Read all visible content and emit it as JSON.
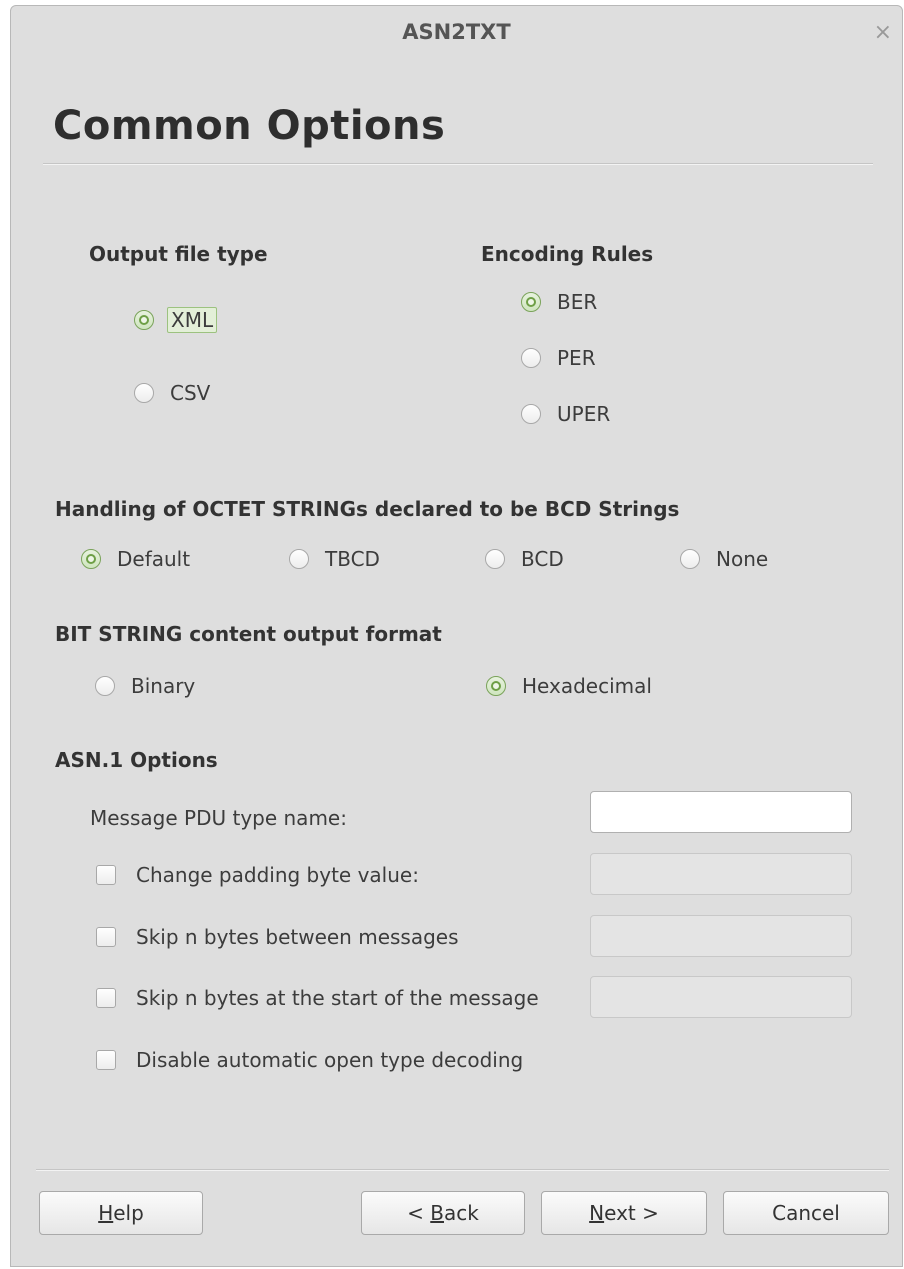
{
  "window": {
    "title": "ASN2TXT",
    "close_glyph": "×"
  },
  "page": {
    "heading": "Common Options"
  },
  "output_file_type": {
    "title": "Output file type",
    "options": [
      {
        "label": "XML",
        "checked": true
      },
      {
        "label": "CSV",
        "checked": false
      }
    ]
  },
  "encoding_rules": {
    "title": "Encoding Rules",
    "options": [
      {
        "label": "BER",
        "checked": true
      },
      {
        "label": "PER",
        "checked": false
      },
      {
        "label": "UPER",
        "checked": false
      }
    ]
  },
  "bcd_handling": {
    "title": "Handling of OCTET STRINGs declared to be BCD Strings",
    "options": [
      {
        "label": "Default",
        "checked": true
      },
      {
        "label": "TBCD",
        "checked": false
      },
      {
        "label": "BCD",
        "checked": false
      },
      {
        "label": "None",
        "checked": false
      }
    ]
  },
  "bit_string_format": {
    "title": "BIT STRING content output format",
    "options": [
      {
        "label": "Binary",
        "checked": false
      },
      {
        "label": "Hexadecimal",
        "checked": true
      }
    ]
  },
  "asn1_options": {
    "title": "ASN.1 Options",
    "pdu_label": "Message PDU type name:",
    "pdu_value": "",
    "padding_label": "Change padding byte value:",
    "padding_value": "",
    "skip_between_label": "Skip n bytes between messages",
    "skip_between_value": "",
    "skip_start_label": "Skip n bytes at the start of the message",
    "skip_start_value": "",
    "disable_open_type_label": "Disable automatic open type decoding"
  },
  "buttons": {
    "help": {
      "mnemonic": "H",
      "rest": "elp"
    },
    "back": {
      "prefix": "< ",
      "mnemonic": "B",
      "rest": "ack"
    },
    "next": {
      "mnemonic": "N",
      "rest": "ext >"
    },
    "cancel": "Cancel"
  }
}
